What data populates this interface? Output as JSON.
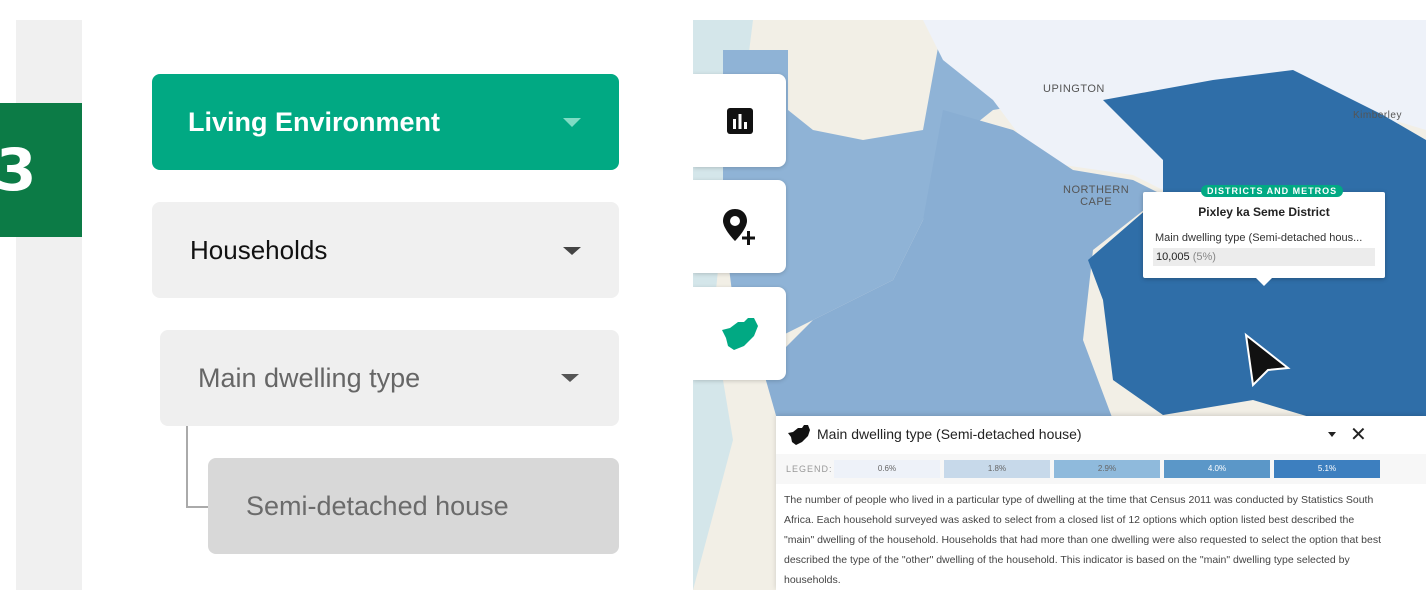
{
  "step": {
    "number": "3"
  },
  "filters": {
    "category": "Living Environment",
    "subcategory": "Households",
    "indicator": "Main dwelling type",
    "value": "Semi-detached house"
  },
  "map": {
    "labels": {
      "upington": "UPINGTON",
      "northern_cape": "NORTHERN\nCAPE",
      "kimberley": "Kimberley"
    },
    "tools": [
      "chart-icon",
      "add-location-icon",
      "south-africa-icon"
    ]
  },
  "tooltip": {
    "tag": "DISTRICTS AND METROS",
    "title": "Pixley ka Seme District",
    "indicator": "Main dwelling type (Semi-detached hous...",
    "value": "10,005",
    "percent": "(5%)"
  },
  "panel": {
    "title": "Main dwelling type (Semi-detached house)",
    "legend_label": "LEGEND:",
    "legend": [
      {
        "label": "0.6%",
        "color": "#eef2f9"
      },
      {
        "label": "1.8%",
        "color": "#c7d9ea"
      },
      {
        "label": "2.9%",
        "color": "#8fbadc"
      },
      {
        "label": "4.0%",
        "color": "#5b97c8"
      },
      {
        "label": "5.1%",
        "color": "#3d7fbf"
      }
    ],
    "description": "The number of people who lived in a particular type of dwelling at the time that Census 2011 was conducted by Statistics South Africa. Each household surveyed was asked to select from a closed list of 12 options which option listed best described the \"main\" dwelling of the household. Households that had more than one dwelling were also requested to select the option that best described the type of the \"other\" dwelling of the household. This indicator is based on the \"main\" dwelling type selected by households."
  },
  "colors": {
    "accent": "#01a983",
    "badge": "#0c7b46",
    "district": "#2f6ea8"
  }
}
